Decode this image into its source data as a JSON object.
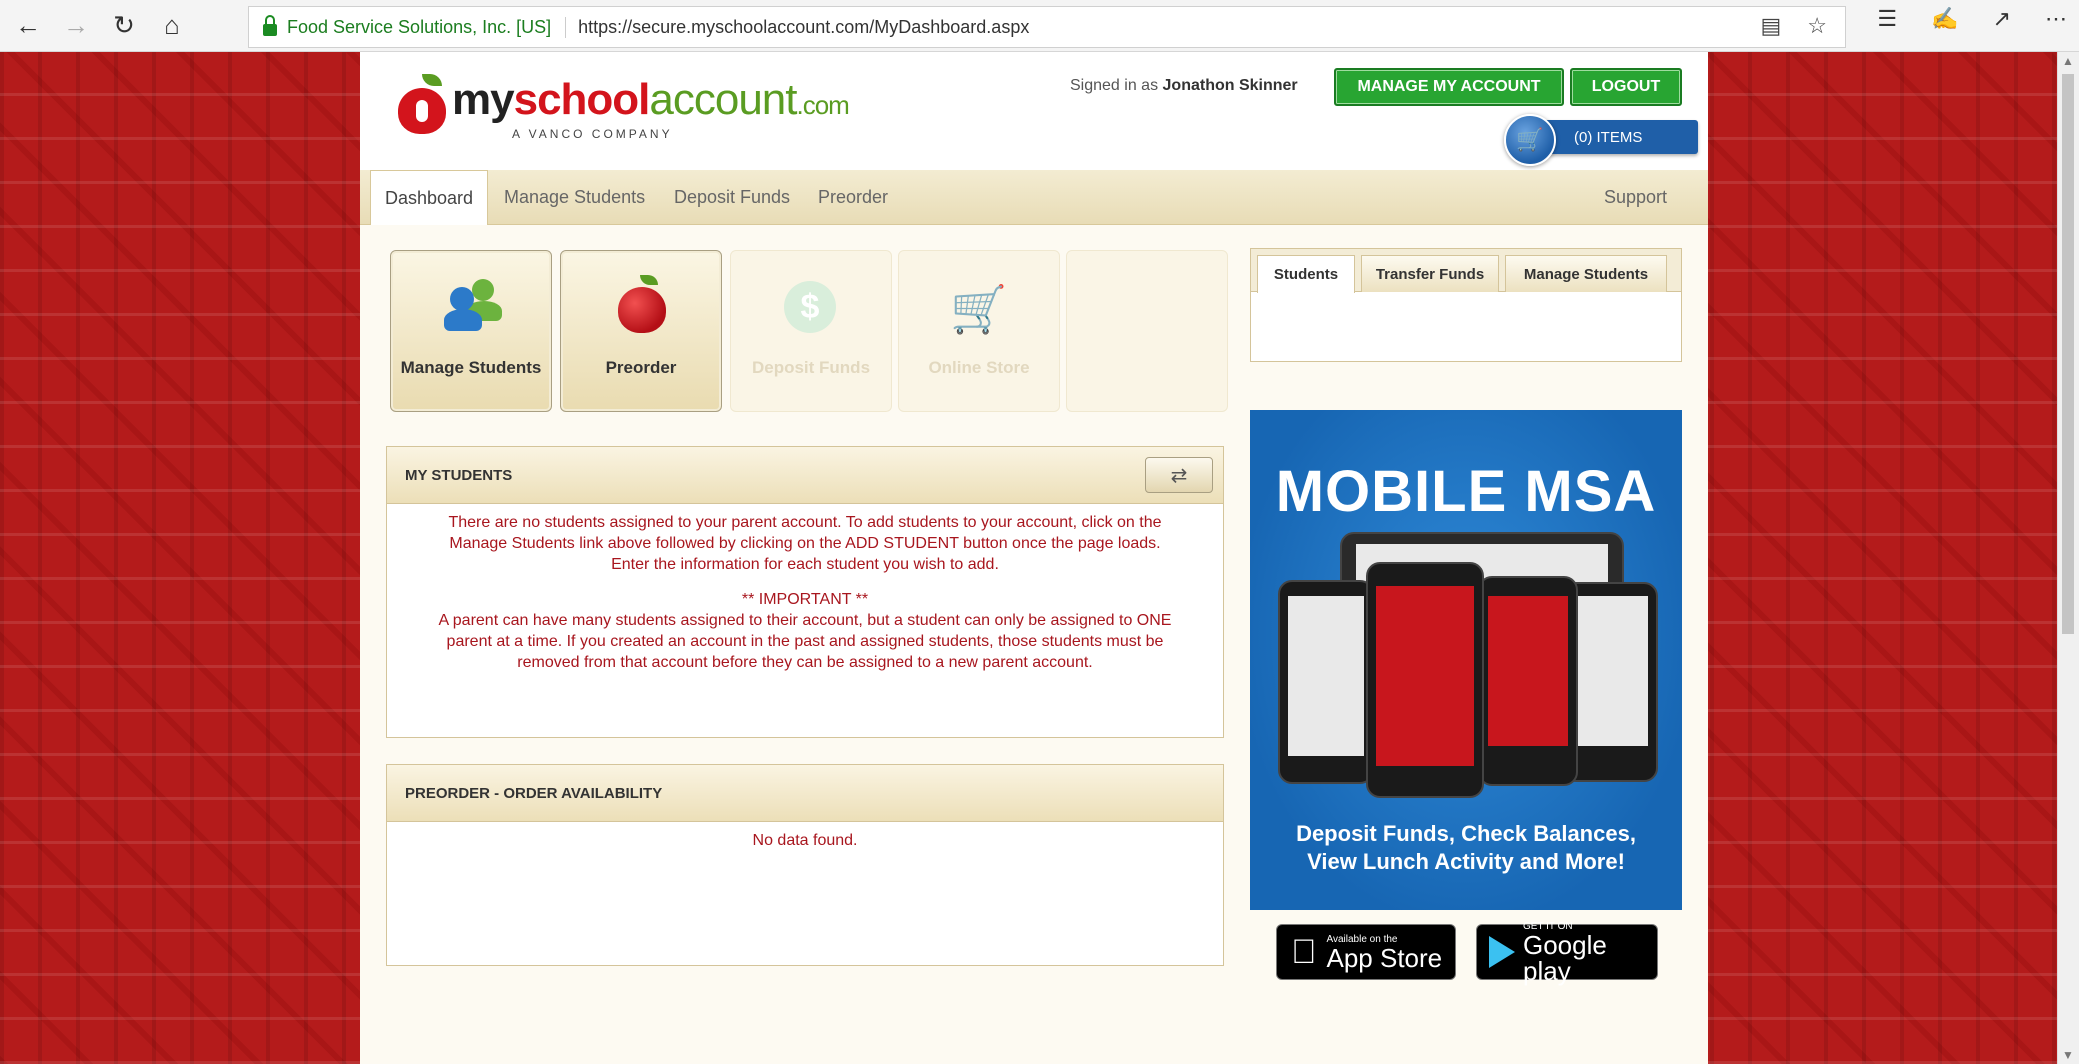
{
  "browser": {
    "site_identity": "Food Service Solutions, Inc. [US]",
    "url": "https://secure.myschoolaccount.com/MyDashboard.aspx"
  },
  "header": {
    "logo": {
      "my": "my",
      "school": "school",
      "account": "account",
      "com": ".com",
      "tagline": "A VANCO COMPANY"
    },
    "signed_in_prefix": "Signed in as",
    "user_name": "Jonathon Skinner",
    "manage_account_label": "MANAGE MY ACCOUNT",
    "logout_label": "LOGOUT",
    "cart_label": "(0) ITEMS"
  },
  "nav": {
    "items": [
      {
        "label": "Dashboard"
      },
      {
        "label": "Manage Students"
      },
      {
        "label": "Deposit Funds"
      },
      {
        "label": "Preorder"
      }
    ],
    "support_label": "Support"
  },
  "tiles": [
    {
      "label": "Manage Students",
      "icon": "people-icon",
      "enabled": true
    },
    {
      "label": "Preorder",
      "icon": "apple-icon",
      "enabled": true
    },
    {
      "label": "Deposit Funds",
      "icon": "dollar-icon",
      "enabled": false
    },
    {
      "label": "Online Store",
      "icon": "cart-icon",
      "enabled": false
    },
    {
      "label": "",
      "icon": "",
      "enabled": false
    }
  ],
  "side_tabs": [
    {
      "label": "Students"
    },
    {
      "label": "Transfer Funds"
    },
    {
      "label": "Manage Students"
    }
  ],
  "my_students": {
    "title": "MY STUDENTS",
    "para1_line1": "There are no students assigned to your parent account. To add students to your account, click on the",
    "para1_line2": "Manage Students link above followed by clicking on the ADD STUDENT button once the page loads.",
    "para1_line3": "Enter the information for each student you wish to add.",
    "important": "** IMPORTANT **",
    "para2_line1": "A parent can have many students assigned to their account, but a student can only be assigned to ONE",
    "para2_line2": "parent at a time. If you created an account in the past and assigned students, those students must be",
    "para2_line3": "removed from that account before they can be assigned to a new parent account."
  },
  "preorder": {
    "title": "PREORDER - ORDER AVAILABILITY",
    "empty_message": "No data found."
  },
  "ad": {
    "title": "MOBILE MSA",
    "tagline_line1": "Deposit Funds, Check Balances,",
    "tagline_line2": "View Lunch Activity and More!"
  },
  "stores": {
    "apple_small": "Available on the",
    "apple_big": "App Store",
    "google_small": "GET IT ON",
    "google_big": "Google play"
  },
  "colors": {
    "brand_red": "#d3141c",
    "brand_green": "#28a532",
    "message_red": "#a8161e",
    "cart_blue": "#1f5fa8"
  }
}
